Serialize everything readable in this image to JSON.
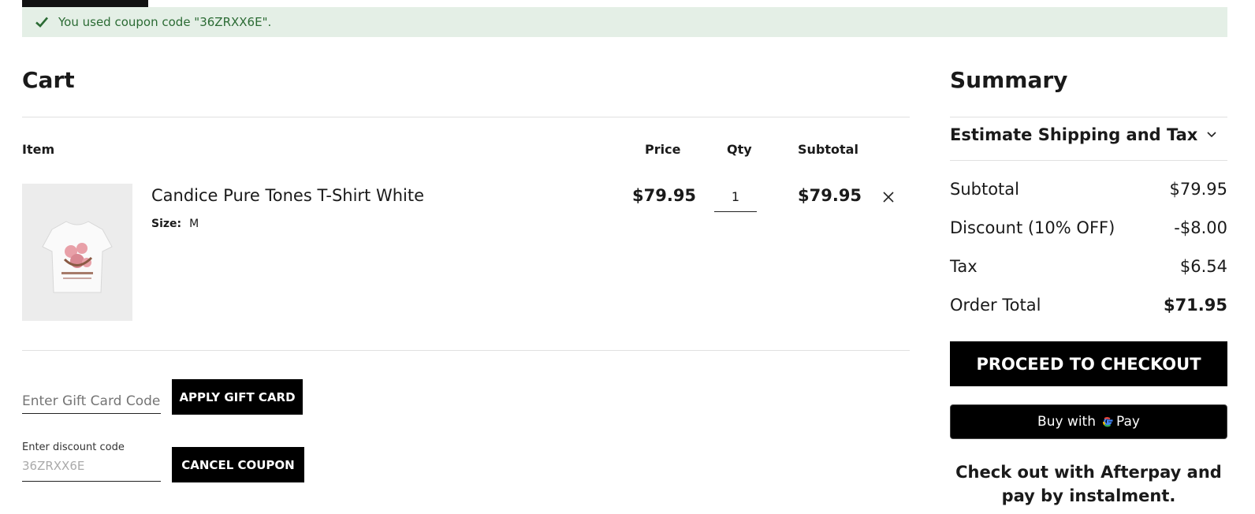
{
  "notice": {
    "text": "You used coupon code \"36ZRXX6E\"."
  },
  "cart": {
    "title": "Cart",
    "headers": {
      "item": "Item",
      "price": "Price",
      "qty": "Qty",
      "subtotal": "Subtotal"
    },
    "items": [
      {
        "name": "Candice Pure Tones T-Shirt White",
        "size_label": "Size:",
        "size_value": "M",
        "price": "$79.95",
        "qty": "1",
        "subtotal": "$79.95"
      }
    ],
    "gift_card": {
      "placeholder": "Enter Gift Card Code",
      "button": "APPLY GIFT CARD"
    },
    "discount": {
      "label": "Enter discount code",
      "value": "36ZRXX6E",
      "button": "CANCEL COUPON"
    }
  },
  "summary": {
    "title": "Summary",
    "estimate": "Estimate Shipping and Tax",
    "rows": [
      {
        "label": "Subtotal",
        "value": "$79.95"
      },
      {
        "label": "Discount (10% OFF)",
        "value": "-$8.00"
      },
      {
        "label": "Tax",
        "value": "$6.54"
      },
      {
        "label": "Order Total",
        "value": "$71.95"
      }
    ],
    "checkout": "PROCEED TO CHECKOUT",
    "gpay": {
      "prefix": "Buy with",
      "brand": "Pay"
    },
    "afterpay": "Check out with Afterpay and pay by instalment."
  },
  "colors": {
    "success_bg": "#e4efe6",
    "success_text": "#2b6b34",
    "button": "#000000"
  }
}
